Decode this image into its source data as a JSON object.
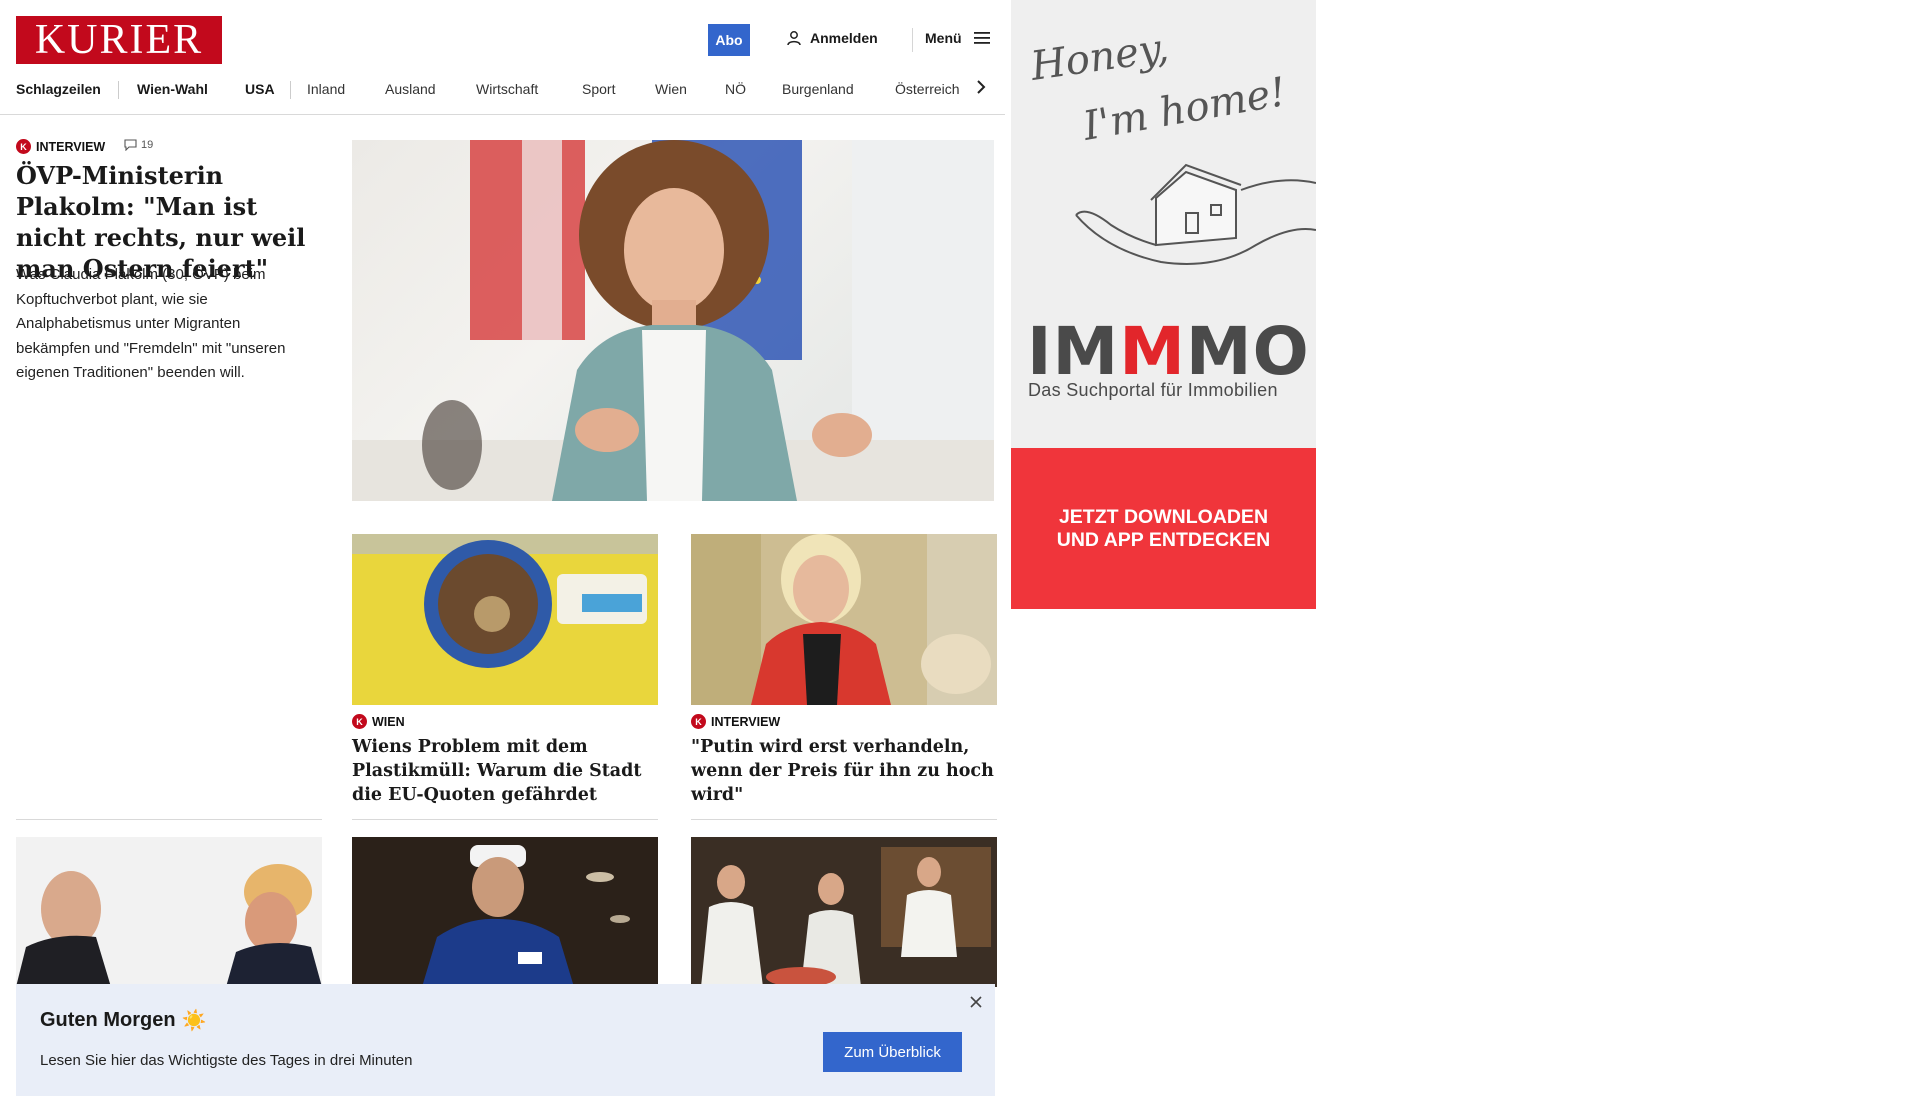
{
  "header": {
    "logo": "KURIER",
    "abo_label": "Abo",
    "login_label": "Anmelden",
    "menu_label": "Menü"
  },
  "nav": {
    "items": [
      "Schlagzeilen",
      "Wien-Wahl",
      "USA",
      "Inland",
      "Ausland",
      "Wirtschaft",
      "Sport",
      "Wien",
      "NÖ",
      "Burgenland",
      "Österreich"
    ]
  },
  "lead": {
    "kicker": "INTERVIEW",
    "comment_count": "19",
    "title": "ÖVP-Ministerin Plakolm: \"Man ist nicht rechts, nur weil man Ostern feiert\"",
    "teaser": "Was Claudia Plakolm (30, ÖVP) beim Kopftuchverbot plant, wie sie Analphabetismus unter Migranten bekämpfen und \"Fremdeln\" mit \"unseren eigenen Traditionen\" beenden will."
  },
  "cards": [
    {
      "kicker": "WIEN",
      "title": "Wiens Problem mit dem Plastikmüll: Warum die Stadt die EU-Quoten gefährdet"
    },
    {
      "kicker": "INTERVIEW",
      "title": "\"Putin wird erst verhandeln, wenn der Preis für ihn zu hoch wird\""
    }
  ],
  "banner": {
    "title": "Guten Morgen",
    "emoji": "☀️",
    "text": "Lesen Sie hier das Wichtigste des Tages in drei Minuten",
    "button": "Zum Überblick"
  },
  "ad": {
    "script_line1": "Honey,",
    "script_line2": "I'm home!",
    "logo_part1": "IM",
    "logo_part2": "M",
    "logo_part3": "MO",
    "subtitle": "Das Suchportal für Immobilien",
    "cta_line1": "JETZT DOWNLOADEN",
    "cta_line2": "UND APP ENTDECKEN"
  },
  "colors": {
    "brand_red": "#c2091c",
    "accent_blue": "#3366cc",
    "ad_red": "#f0353b",
    "banner_bg": "#e9eef8"
  }
}
